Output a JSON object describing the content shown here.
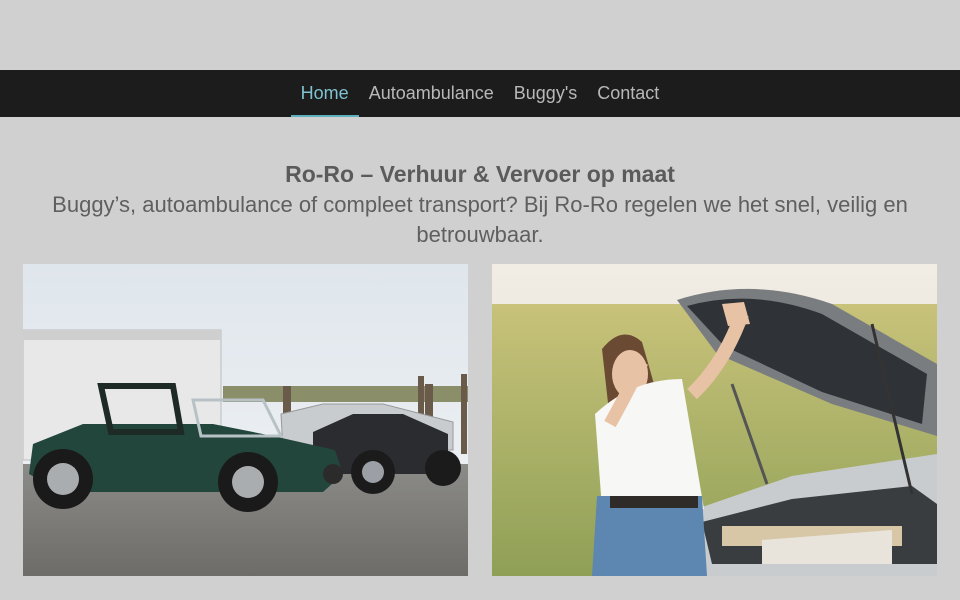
{
  "nav": {
    "items": [
      {
        "label": "Home",
        "active": true
      },
      {
        "label": "Autoambulance",
        "active": false
      },
      {
        "label": "Buggy's",
        "active": false
      },
      {
        "label": "Contact",
        "active": false
      }
    ]
  },
  "hero": {
    "title": "Ro-Ro – Verhuur & Vervoer op maat",
    "subtitle": "Buggy’s, autoambulance of compleet transport? Bij Ro-Ro regelen we het snel, veilig en betrouwbaar."
  },
  "photos": {
    "left": {
      "icon": "buggies-photo"
    },
    "right": {
      "icon": "woman-car-breakdown-photo"
    }
  },
  "colors": {
    "background": "#d0d0d0",
    "navbar": "#1c1c1c",
    "nav_active": "#7ec3cf",
    "nav_text": "#b8b8b8",
    "heading_text": "#5b5b5b"
  }
}
